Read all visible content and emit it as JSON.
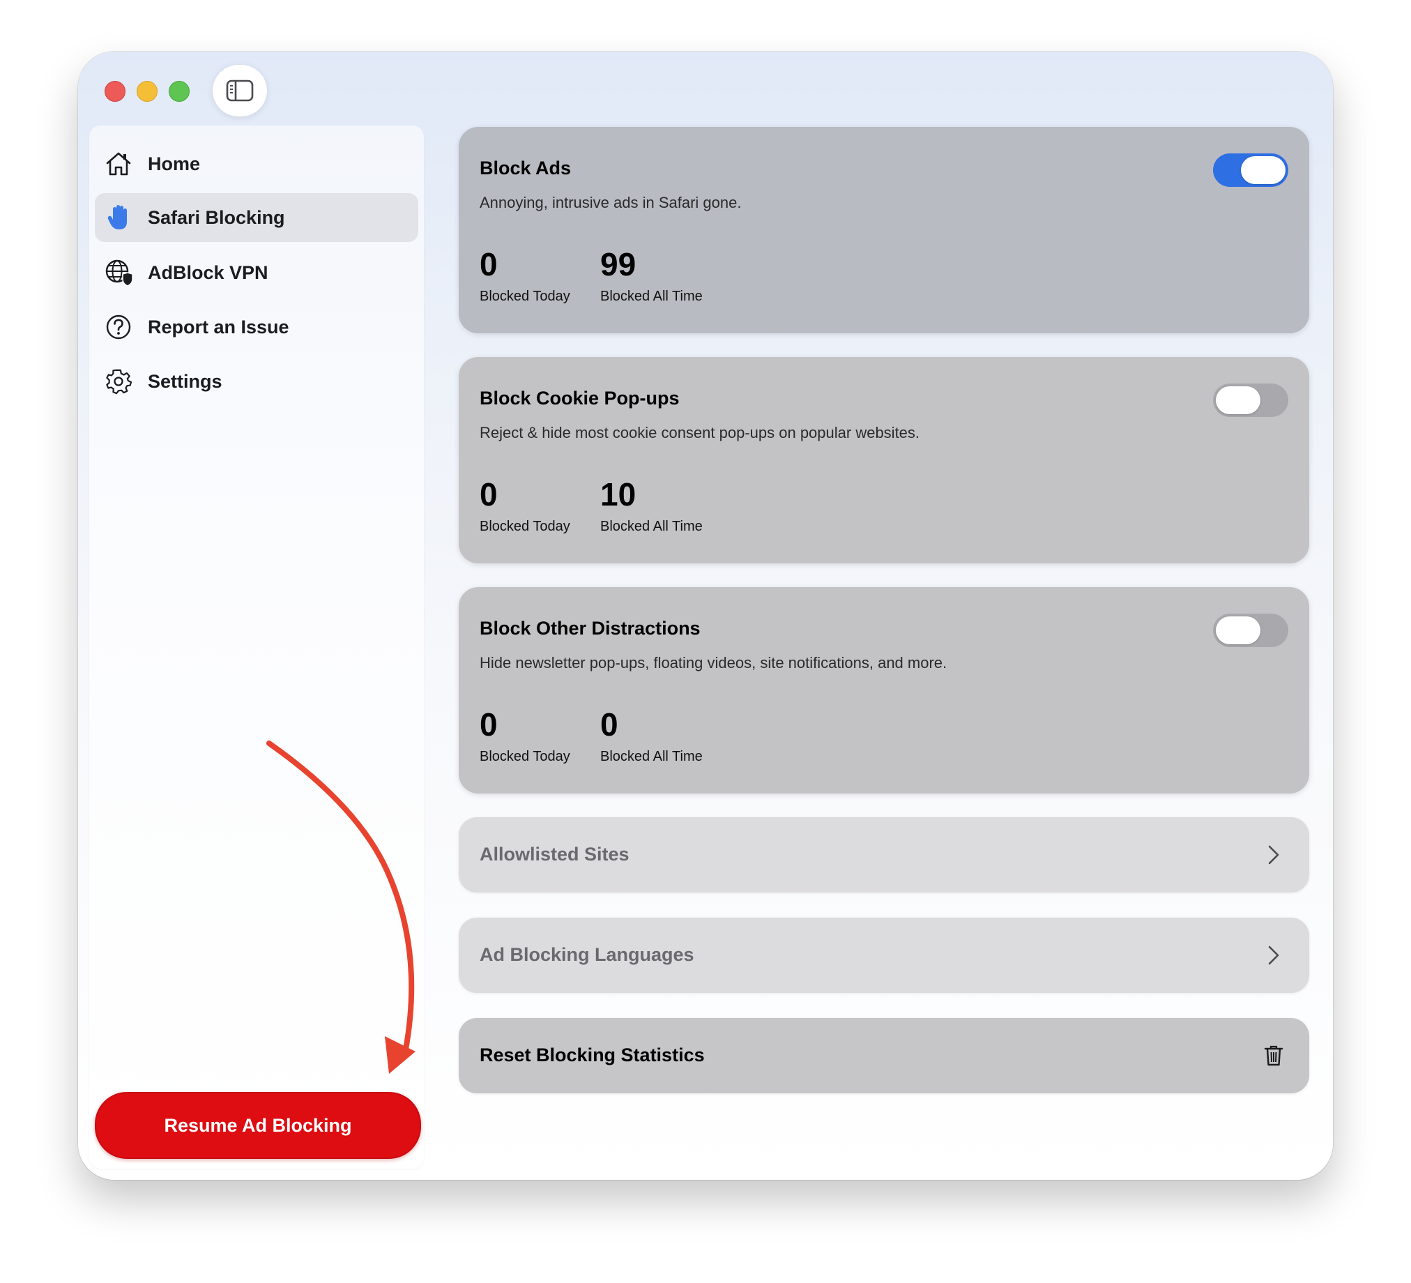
{
  "sidebar": {
    "items": [
      {
        "label": "Home",
        "icon": "house-icon",
        "active": false
      },
      {
        "label": "Safari Blocking",
        "icon": "hand-icon",
        "active": true
      },
      {
        "label": "AdBlock VPN",
        "icon": "globe-shield-icon",
        "active": false
      },
      {
        "label": "Report an Issue",
        "icon": "question-circle-icon",
        "active": false
      },
      {
        "label": "Settings",
        "icon": "gear-icon",
        "active": false
      }
    ],
    "resume_button": "Resume Ad Blocking"
  },
  "cards": [
    {
      "title": "Block Ads",
      "subtitle": "Annoying, intrusive ads in Safari gone.",
      "toggle_on": true,
      "blocked_today": "0",
      "blocked_today_label": "Blocked Today",
      "blocked_all_time": "99",
      "blocked_all_time_label": "Blocked All Time"
    },
    {
      "title": "Block Cookie Pop-ups",
      "subtitle": "Reject & hide most cookie consent pop-ups on popular websites.",
      "toggle_on": false,
      "blocked_today": "0",
      "blocked_today_label": "Blocked Today",
      "blocked_all_time": "10",
      "blocked_all_time_label": "Blocked All Time"
    },
    {
      "title": "Block Other Distractions",
      "subtitle": "Hide newsletter pop-ups, floating videos, site notifications, and more.",
      "toggle_on": false,
      "blocked_today": "0",
      "blocked_today_label": "Blocked Today",
      "blocked_all_time": "0",
      "blocked_all_time_label": "Blocked All Time"
    }
  ],
  "rows": [
    {
      "label": "Allowlisted Sites",
      "icon": "chevron-right-icon"
    },
    {
      "label": "Ad Blocking Languages",
      "icon": "chevron-right-icon"
    },
    {
      "label": "Reset Blocking Statistics",
      "icon": "trash-icon"
    }
  ],
  "colors": {
    "accent_blue": "#2f6fe4",
    "resume_red": "#de0d12",
    "annotation_arrow": "#e8432e"
  }
}
